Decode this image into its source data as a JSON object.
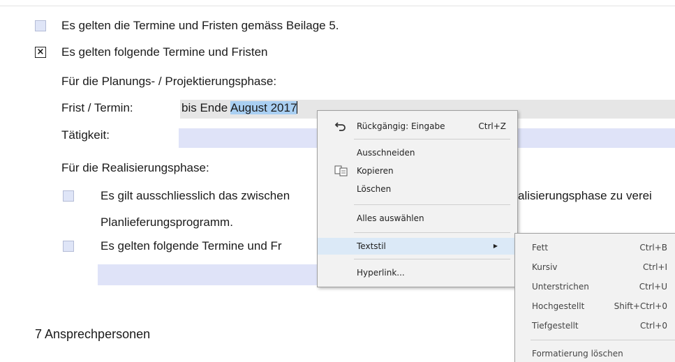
{
  "document": {
    "option1_text": "Es gelten die Termine und Fristen gemäss Beilage 5.",
    "option2_text": "Es gelten folgende Termine und Fristen",
    "option2_mark": "×",
    "planning_phase_label": "Für die Planungs- / Projektierungsphase:",
    "deadline_label": "Frist / Termin:",
    "deadline_value_prefix": "bis Ende ",
    "deadline_value_selected": "August 2017",
    "activity_label": "Tätigkeit:",
    "realization_phase_label": "Für die Realisierungsphase:",
    "realization_option1_text_left": "Es gilt ausschliesslich das zwischen",
    "realization_option1_text_right": "alisierungsphase zu verei",
    "realization_option1_line2": "Planlieferungsprogramm.",
    "realization_option2_text": "Es gelten folgende Termine und Fr",
    "section_heading": "7 Ansprechpersonen"
  },
  "context_menu": {
    "items": [
      {
        "label": "Rückgängig: Eingabe",
        "shortcut": "Ctrl+Z",
        "icon": "undo-icon"
      },
      {
        "label": "Ausschneiden"
      },
      {
        "label": "Kopieren",
        "icon": "copy-icon"
      },
      {
        "label": "Löschen"
      },
      {
        "label": "Alles auswählen"
      },
      {
        "label": "Textstil",
        "submenu_arrow": "▶"
      },
      {
        "label": "Hyperlink..."
      }
    ]
  },
  "text_style_submenu": {
    "items": [
      {
        "label": "Fett",
        "shortcut": "Ctrl+B"
      },
      {
        "label": "Kursiv",
        "shortcut": "Ctrl+I"
      },
      {
        "label": "Unterstrichen",
        "shortcut": "Ctrl+U"
      },
      {
        "label": "Hochgestellt",
        "shortcut": "Shift+Ctrl+0"
      },
      {
        "label": "Tiefgestellt",
        "shortcut": "Ctrl+0"
      },
      {
        "label": "Formatierung löschen"
      }
    ]
  },
  "colors": {
    "selection": "#a9cff2",
    "field_blue": "#dfe3f8",
    "menu_highlight": "#dbe9f7",
    "menu_background": "#f2f2f2"
  }
}
